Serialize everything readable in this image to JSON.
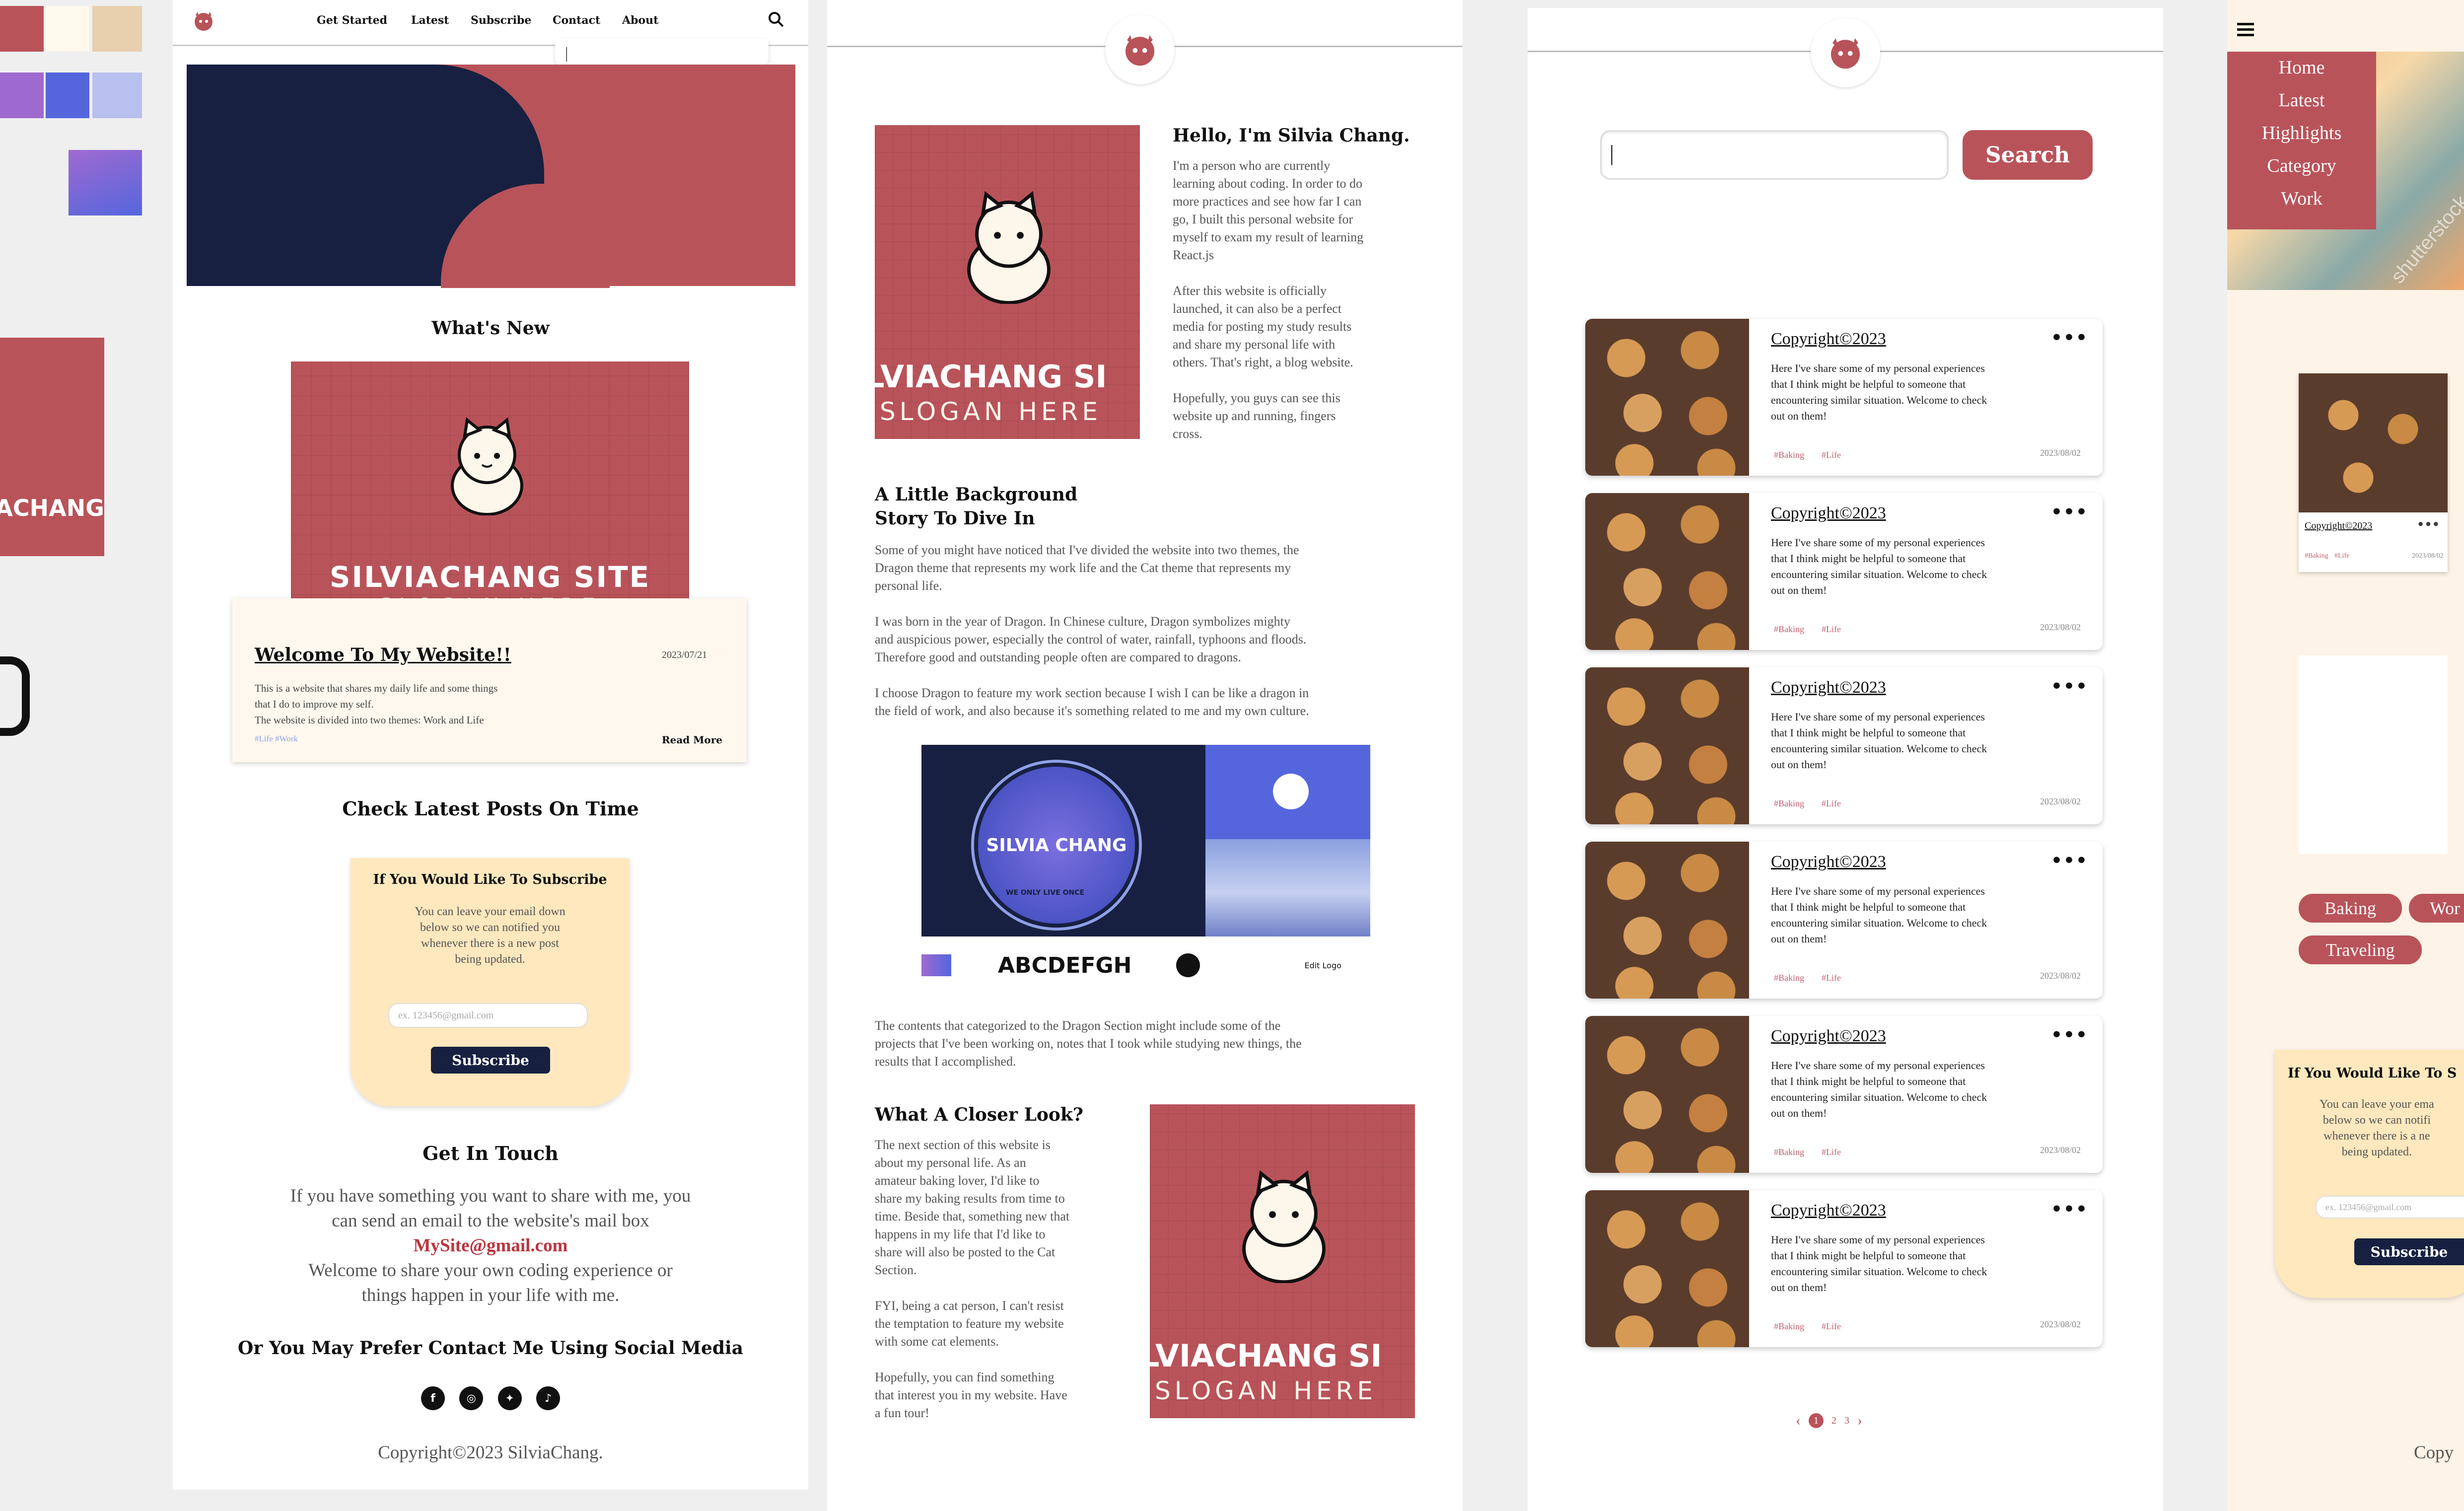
{
  "nav": {
    "links": [
      "Get Started",
      "Latest",
      "Subscribe",
      "Contact",
      "About"
    ],
    "search_cursor": "|"
  },
  "home": {
    "whats_new": "What's New",
    "banner_name": "SILVIACHANG SITE",
    "banner_slogan": "SLOGAN HERE",
    "post_title": "Welcome To My Website!!",
    "post_date": "2023/07/21",
    "post_text": [
      "This is a website that shares my daily life and some things",
      "that I do to improve my self.",
      "The website is divided into two themes: Work and Life"
    ],
    "post_tags": "#Life #Work",
    "read_more": "Read More",
    "latest_heading": "Check Latest Posts On Time",
    "subscribe": {
      "title": "If You Would Like To Subscribe",
      "text": [
        "You can leave your email down",
        "below so we can notified you",
        "whenever there is a new post",
        "being updated."
      ],
      "placeholder": "ex. 123456@gmail.com",
      "button": "Subscribe"
    },
    "touch_heading": "Get In Touch",
    "touch_text": [
      "If you have something you want to share with me, you",
      "can send an email to the website's mail box"
    ],
    "email": "MySite@gmail.com",
    "touch_text2": [
      "Welcome to share your own coding experience or",
      "things happen in your life with me."
    ],
    "social_heading": "Or You May Prefer Contact Me Using Social Media",
    "social_icons": [
      "facebook-icon",
      "instagram-icon",
      "twitter-icon",
      "tiktok-icon"
    ],
    "footer": "Copyright©2023 SilviaChang."
  },
  "about": {
    "hello": "Hello, I'm Silvia Chang.",
    "p1": [
      "I'm a person who are currently",
      "learning about coding. In order to do",
      "more practices and see how far I can",
      "go, I built this personal website for",
      "myself to exam my result of learning",
      "React.js"
    ],
    "p2": [
      "After this website is officially",
      "launched, it can also be a perfect",
      "media for posting my study results",
      "and share my personal life with",
      "others. That's right, a blog website."
    ],
    "p3": [
      "Hopefully, you guys can see this",
      "website up and running, fingers",
      "cross."
    ],
    "bg_title": [
      "A Little Background",
      "Story To Dive In"
    ],
    "bg_p1": [
      "Some of you might have noticed that I've divided the website into two themes, the",
      "Dragon theme that represents my work life and the Cat theme that represents my",
      "personal life."
    ],
    "bg_p2": [
      "I was born in the year of Dragon. In Chinese culture, Dragon symbolizes mighty",
      "and auspicious power, especially the control of water, rainfall, typhoons and floods.",
      "Therefore good and outstanding people often are compared to dragons."
    ],
    "bg_p3": [
      "I choose Dragon to feature my work section because I wish I can be like a dragon in",
      "the field of work, and also because it's something related to me and my own culture."
    ],
    "logo_name": "SILVIA CHANG",
    "logo_motto": "WE ONLY LIVE ONCE",
    "font_sample": "ABCDEFGH",
    "edit_logo": "Edit Logo",
    "dragon_p": [
      "The contents that categorized to the Dragon Section might include some of the",
      "projects that I've been working on, notes that I took while studying new things, the",
      "results that I accomplished."
    ],
    "closer_title": "What A Closer Look?",
    "closer_p1": [
      "The next section of this website is",
      "about my personal life. As an",
      "amateur baking lover, I'd like to",
      "share my baking results from time to",
      "time. Beside that, something new that",
      "happens in my life that I'd like to",
      "share will also be posted to the Cat",
      "Section."
    ],
    "closer_p2": [
      "FYI, being a cat person, I can't resist",
      "the temptation to feature my website",
      "with some cat elements."
    ],
    "closer_p3": [
      "Hopefully, you can find something",
      "that interest you in my website. Have",
      "a fun tour!"
    ],
    "banner_cut": "LVIACHANG SI",
    "slogan": "SLOGAN HERE"
  },
  "search_page": {
    "button": "Search",
    "cards": [
      {
        "title": "Copyright©2023",
        "text": [
          "Here I've share some of my personal experiences",
          "that I think might be helpful to someone that",
          "encountering similar situation. Welcome to check",
          "out on them!"
        ],
        "tags": [
          "#Baking",
          "#Life"
        ],
        "date": "2023/08/02"
      },
      {
        "title": "Copyright©2023",
        "text": [
          "Here I've share some of my personal experiences",
          "that I think might be helpful to someone that",
          "encountering similar situation. Welcome to check",
          "out on them!"
        ],
        "tags": [
          "#Baking",
          "#Life"
        ],
        "date": "2023/08/02"
      },
      {
        "title": "Copyright©2023",
        "text": [
          "Here I've share some of my personal experiences",
          "that I think might be helpful to someone that",
          "encountering similar situation. Welcome to check",
          "out on them!"
        ],
        "tags": [
          "#Baking",
          "#Life"
        ],
        "date": "2023/08/02"
      },
      {
        "title": "Copyright©2023",
        "text": [
          "Here I've share some of my personal experiences",
          "that I think might be helpful to someone that",
          "encountering similar situation. Welcome to check",
          "out on them!"
        ],
        "tags": [
          "#Baking",
          "#Life"
        ],
        "date": "2023/08/02"
      },
      {
        "title": "Copyright©2023",
        "text": [
          "Here I've share some of my personal experiences",
          "that I think might be helpful to someone that",
          "encountering similar situation. Welcome to check",
          "out on them!"
        ],
        "tags": [
          "#Baking",
          "#Life"
        ],
        "date": "2023/08/02"
      },
      {
        "title": "Copyright©2023",
        "text": [
          "Here I've share some of my personal experiences",
          "that I think might be helpful to someone that",
          "encountering similar situation. Welcome to check",
          "out on them!"
        ],
        "tags": [
          "#Baking",
          "#Life"
        ],
        "date": "2023/08/02"
      }
    ],
    "pages": [
      "1",
      "2",
      "3"
    ]
  },
  "mobile": {
    "menu": [
      "Home",
      "Latest",
      "Highlights",
      "Category",
      "Work"
    ],
    "watermark": "shutterstock",
    "mini_card_title": "Copyright©2023",
    "mini_tags": [
      "#Baking",
      "#Life"
    ],
    "mini_date": "2023/08/02",
    "chips": [
      "Baking",
      "Wor",
      "Traveling"
    ],
    "subscribe_title": "If You Would Like To S",
    "subscribe_text": [
      "You can leave your ema",
      "below so we can notifi",
      "whenever there is a ne",
      "being updated."
    ],
    "placeholder": "ex. 123456@gmail.com",
    "subscribe_btn": "Subscribe",
    "footer_cut": "Copy"
  },
  "colors": {
    "brand_red": "#b9535a",
    "navy": "#172040",
    "cream": "#fff8ec",
    "peach": "#ffe8bd",
    "blue": "#5566dd",
    "purple": "#9f6ad0"
  }
}
